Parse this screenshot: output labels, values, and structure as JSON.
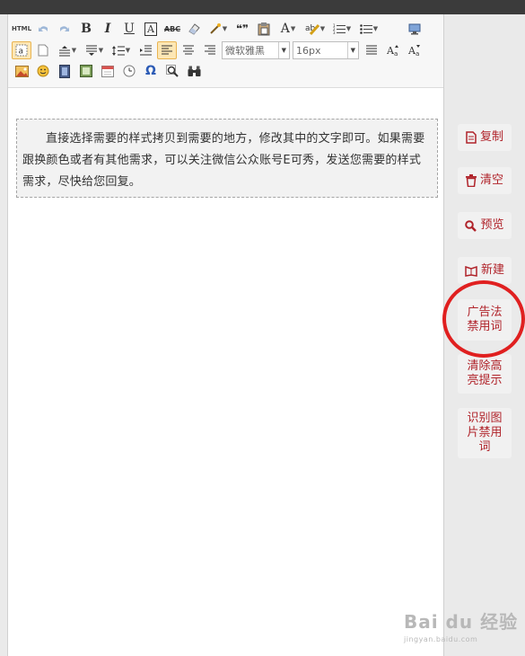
{
  "toolbar": {
    "html_label": "HTML",
    "bold": "B",
    "italic": "I",
    "underline": "U",
    "font_border": "A",
    "strike": "ABC",
    "quote": "❝❞",
    "font_color": "A",
    "font_family": "微软雅黑",
    "font_size": "16px"
  },
  "content": {
    "text": "直接选择需要的样式拷贝到需要的地方，修改其中的文字即可。如果需要跟换颜色或者有其他需求，可以关注微信公众账号E可秀，发送您需要的样式需求，尽快给您回复。"
  },
  "sidebar": {
    "copy": "复制",
    "clear": "清空",
    "preview": "预览",
    "new": "新建",
    "ad_law": "广告法\n禁用词",
    "clear_highlight": "清除高\n亮提示",
    "image_words": "识别图\n片禁用\n词"
  },
  "watermark": {
    "brand": "Bai du 经验",
    "sub": "jingyan.baidu.com"
  },
  "colors": {
    "accent": "#b0232a",
    "annotation": "#e02020",
    "active_tool": "#fde7b5"
  }
}
